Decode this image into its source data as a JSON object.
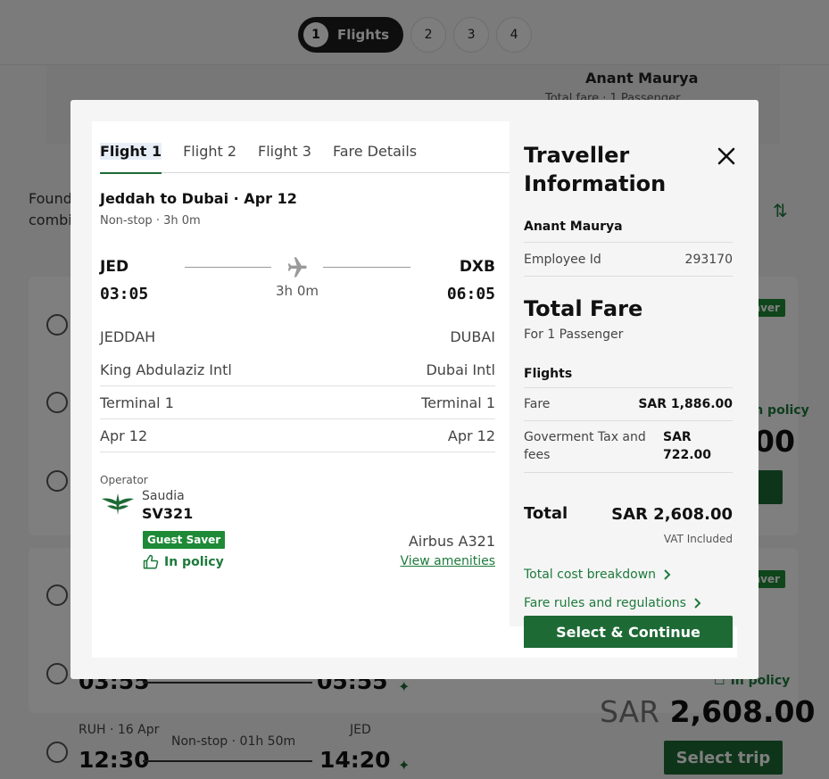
{
  "stepper": {
    "active_num": "1",
    "active_label": "Flights",
    "steps": [
      "2",
      "3",
      "4"
    ]
  },
  "background": {
    "traveller_name": "Anant Maurya",
    "fare_sub": "Total fare · 1 Passenger",
    "found_line1": "Found",
    "found_line2": "combi",
    "badge_saver": "aver",
    "in_policy": "In policy",
    "price_currency": "SAR",
    "price_value": "2,608.00",
    "select_trip": "Select trip",
    "trip2_time_dep": "03:55",
    "trip2_time_arr": "05:55",
    "trip3_origin": "RUH · 16 Apr",
    "trip3_dest": "JED",
    "trip3_stops": "Non-stop · 01h 50m",
    "trip3_time_dep": "12:30",
    "trip3_time_arr": "14:20",
    "partial_price": "00"
  },
  "modal": {
    "tabs": [
      "Flight 1",
      "Flight 2",
      "Flight 3",
      "Fare Details"
    ],
    "route_title": "Jeddah to Dubai · Apr 12",
    "route_sub": "Non-stop · 3h 0m",
    "origin_code": "JED",
    "dest_code": "DXB",
    "dep_time": "03:05",
    "arr_time": "06:05",
    "duration": "3h 0m",
    "details": [
      {
        "left": "JEDDAH",
        "right": "DUBAI"
      },
      {
        "left": "King Abdulaziz Intl",
        "right": "Dubai Intl"
      },
      {
        "left": "Terminal 1",
        "right": "Terminal 1"
      },
      {
        "left": "Apr 12",
        "right": "Apr 12"
      }
    ],
    "operator_label": "Operator",
    "airline": "Saudia",
    "flight_no": "SV321",
    "badge": "Guest Saver",
    "in_policy": "In policy",
    "aircraft": "Airbus A321",
    "amenities": "View amenities"
  },
  "traveller_panel": {
    "title_line1": "Traveller",
    "title_line2": "Information",
    "name": "Anant Maurya",
    "employee_label": "Employee Id",
    "employee_id": "293170",
    "total_fare_title": "Total Fare",
    "total_fare_sub": "For 1 Passenger",
    "flights_label": "Flights",
    "fare_label": "Fare",
    "fare_amount": "SAR 1,886.00",
    "tax_label": "Goverment Tax and fees",
    "tax_amount": "SAR 722.00",
    "total_label": "Total",
    "total_amount": "SAR 2,608.00",
    "vat": "VAT Included",
    "link_breakdown": "Total cost breakdown",
    "link_rules": "Fare rules and regulations",
    "button_label": "Select & Continue"
  },
  "colors": {
    "brand_green": "#1d6a35",
    "badge_green": "#1e8a37",
    "link_green": "#1d7a3c"
  }
}
